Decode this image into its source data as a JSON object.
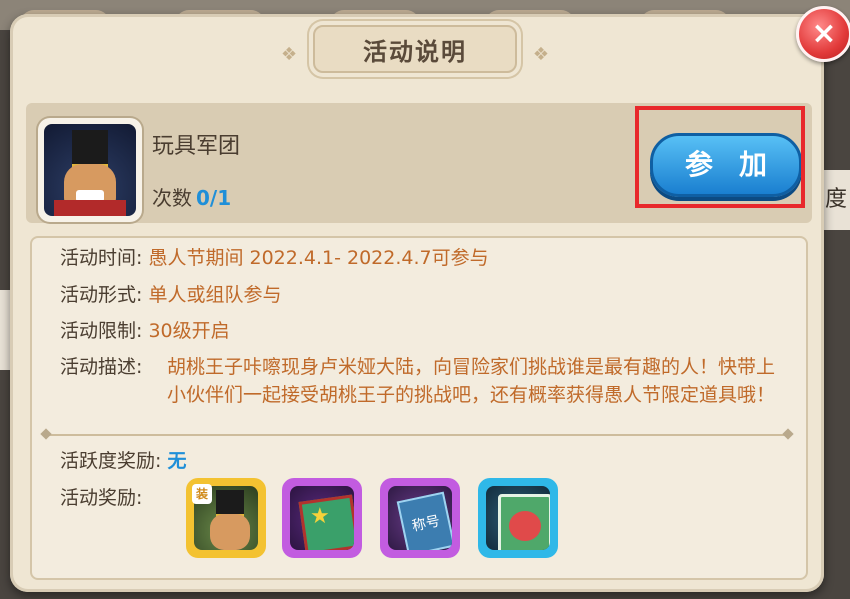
{
  "dialog": {
    "title": "活动说明",
    "close_label": "×"
  },
  "activity": {
    "name": "玩具军团",
    "count_label": "次数",
    "count_value": "0/1",
    "join_label": "参加"
  },
  "details": {
    "time_key": "活动时间:",
    "time_value": "愚人节期间 2022.4.1- 2022.4.7可参与",
    "form_key": "活动形式:",
    "form_value": "单人或组队参与",
    "limit_key": "活动限制:",
    "limit_value": "30级开启",
    "desc_key": "活动描述:",
    "desc_value": "胡桃王子咔嚓现身卢米娅大陆，向冒险家们挑战谁是最有趣的人！快带上小伙伴们一起接受胡桃王子的挑战吧，还有概率获得愚人节限定道具哦！"
  },
  "rewards": {
    "activity_key": "活跃度奖励:",
    "activity_value": "无",
    "rewards_key": "活动奖励:",
    "items": [
      {
        "icon": "nutcracker-avatar-icon",
        "badge": "装"
      },
      {
        "icon": "star-box-icon"
      },
      {
        "icon": "title-card-icon",
        "text": "称号"
      },
      {
        "icon": "jester-card-icon"
      }
    ]
  },
  "background": {
    "side_text": "度"
  },
  "colors": {
    "accent_blue": "#1f8fd8",
    "value_orange": "#c06a2a",
    "highlight_red": "#e8282b"
  }
}
